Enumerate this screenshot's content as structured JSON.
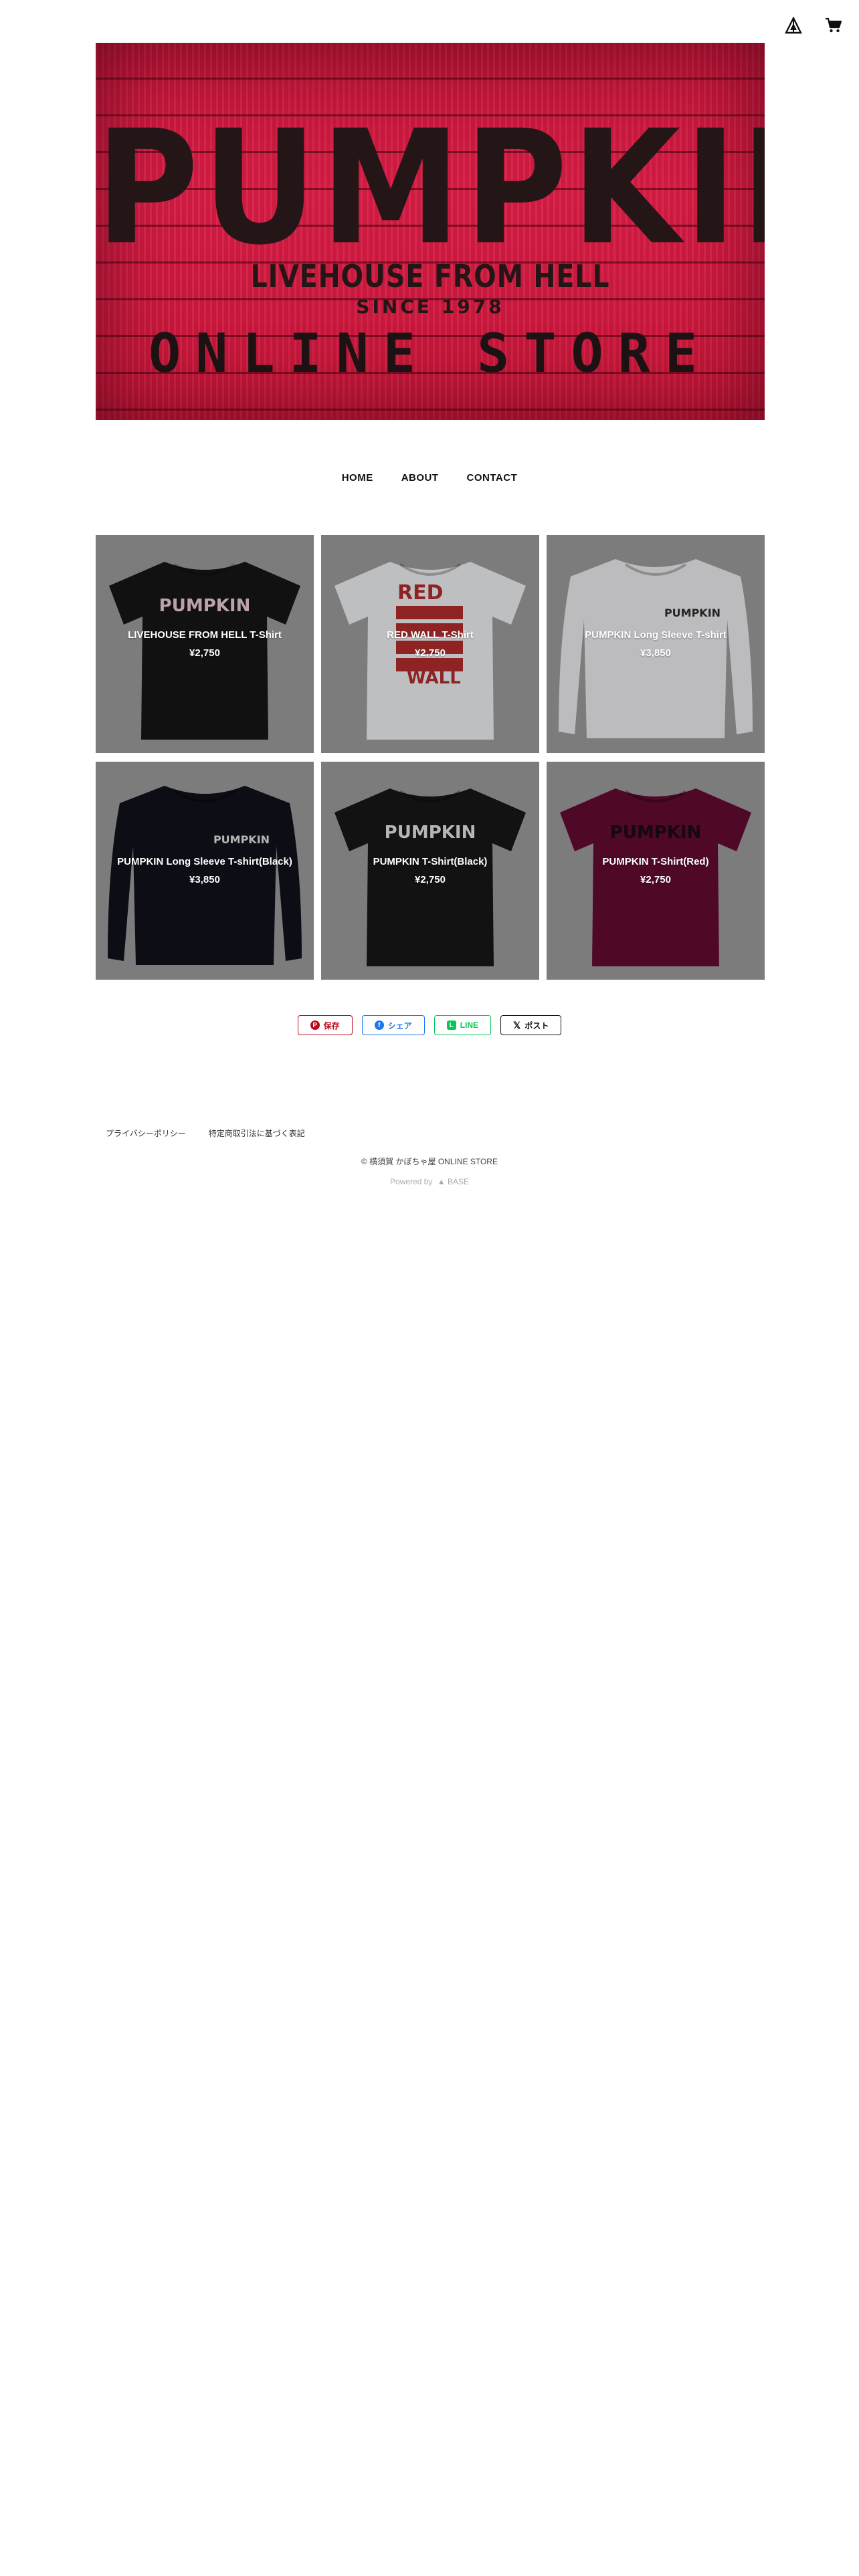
{
  "header": {
    "icons": [
      "base-logo-icon",
      "cart-icon"
    ],
    "banner": {
      "title": "PUMPKIN",
      "subtitle": "LIVEHOUSE FROM HELL",
      "since": "SINCE 1978",
      "store_text": "ONLINE STORE",
      "background_color": "#d21a3f",
      "text_color": "#241617"
    }
  },
  "nav": {
    "items": [
      {
        "label": "HOME"
      },
      {
        "label": "ABOUT"
      },
      {
        "label": "CONTACT"
      }
    ]
  },
  "products": [
    {
      "name": "LIVEHOUSE FROM HELL T-Shirt",
      "price": "¥2,750",
      "shirt_color": "#141414",
      "sleeve": "short",
      "print": "PUMPKIN",
      "print_color": "#d6b8c4"
    },
    {
      "name": "RED WALL T-Shirt",
      "price": "¥2,750",
      "shirt_color": "#d8dadb",
      "sleeve": "short",
      "print": "RED WALL",
      "print_color": "#a3282a"
    },
    {
      "name": "PUMPKIN Long Sleeve T-shirt",
      "price": "¥3,850",
      "shirt_color": "#d6d7d9",
      "sleeve": "long",
      "print": "PUMPKIN",
      "print_color": "#2a2a2a"
    },
    {
      "name": "PUMPKIN Long Sleeve T-shirt(Black)",
      "price": "¥3,850",
      "shirt_color": "#0e0f18",
      "sleeve": "long",
      "print": "PUMPKIN",
      "print_color": "#cfcfcf"
    },
    {
      "name": "PUMPKIN T-Shirt(Black)",
      "price": "¥2,750",
      "shirt_color": "#151515",
      "sleeve": "short",
      "print": "PUMPKIN",
      "print_color": "#cfcfcf"
    },
    {
      "name": "PUMPKIN T-Shirt(Red)",
      "price": "¥2,750",
      "shirt_color": "#5a0a2c",
      "sleeve": "short",
      "print": "PUMPKIN",
      "print_color": "#1a0a12"
    }
  ],
  "share": {
    "save": {
      "label": "保存",
      "color": "#bd081c"
    },
    "facebook": {
      "label": "シェア",
      "color": "#1877f2"
    },
    "line": {
      "label": "LINE",
      "color": "#06c755"
    },
    "x": {
      "label": "ポスト",
      "color": "#111111"
    }
  },
  "footer": {
    "links": [
      {
        "label": "プライバシーポリシー"
      },
      {
        "label": "特定商取引法に基づく表記"
      }
    ],
    "copyright": "© 横須賀 かぼちゃ屋 ONLINE STORE",
    "powered_by": "Powered by"
  }
}
